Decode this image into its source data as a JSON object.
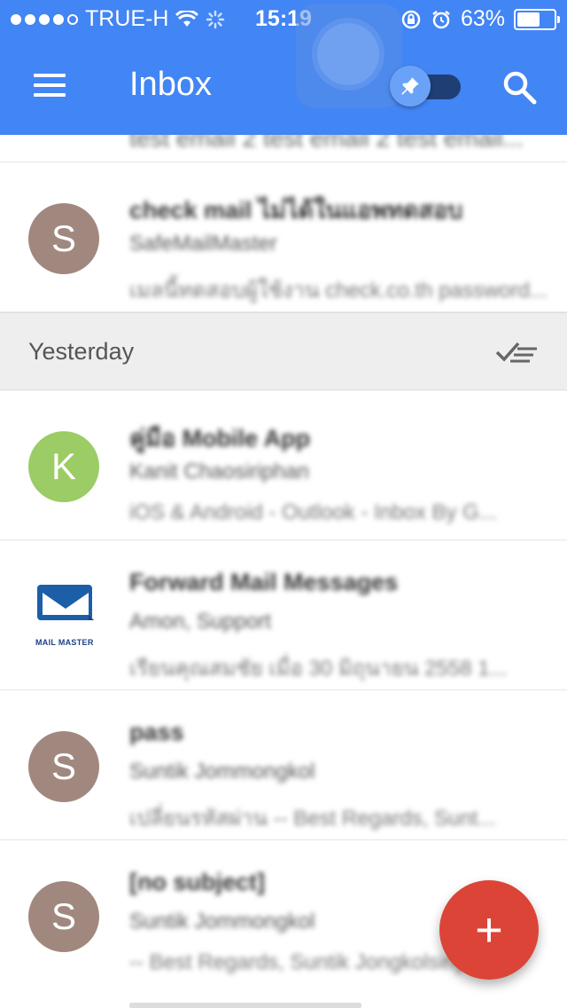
{
  "status_bar": {
    "carrier": "TRUE-H",
    "time": "15:19",
    "battery": "63%",
    "battery_level": 0.63
  },
  "header": {
    "title": "Inbox"
  },
  "list": {
    "partial_top_preview": "test email 2 test email 2 test email...",
    "today": [
      {
        "avatar_letter": "S",
        "avatar_color": "#a1887f",
        "subject": "check mail ไม่ได้ในแอพทดสอบ",
        "sender": "SafeMailMaster",
        "snippet": "เมลนี้ทดสอบผู้ใช้งาน check.co.th password..."
      }
    ],
    "section_label": "Yesterday",
    "yesterday": [
      {
        "avatar_letter": "K",
        "avatar_color": "#9ccc65",
        "subject": "คู่มือ Mobile App",
        "sender": "Kanit Chaosiriphan",
        "snippet": "iOS & Android - Outlook - Inbox By G..."
      },
      {
        "avatar_logo": "mail-master",
        "logo_text": "MAIL MASTER",
        "subject": "Forward Mail Messages",
        "sender": "Amon, Support",
        "snippet": "เรียนคุณสมชัย เมื่อ 30 มิถุนายน 2558 1..."
      },
      {
        "avatar_letter": "S",
        "avatar_color": "#a1887f",
        "subject": "pass",
        "sender": "Suntik Jommongkol",
        "snippet": "เปลี่ยนรหัสผ่าน -- Best Regards, Sunt..."
      },
      {
        "avatar_letter": "S",
        "avatar_color": "#a1887f",
        "subject": "[no subject]",
        "sender": "Suntik Jommongkol",
        "snippet": "-- Best Regards, Suntik Jongkolsiriy..."
      }
    ]
  },
  "fab": {
    "label": "+"
  }
}
